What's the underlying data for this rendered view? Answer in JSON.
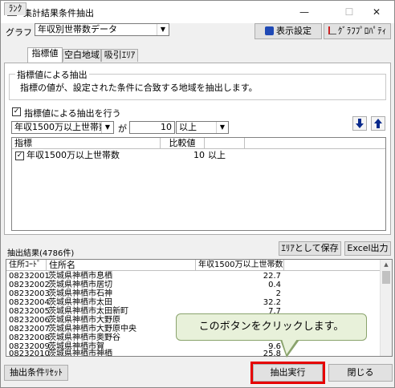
{
  "window": {
    "title": "集計結果条件抽出",
    "minimize": "—",
    "maximize": "☐",
    "close": "✕"
  },
  "graph": {
    "label": "グラフ",
    "selected": "年収別世帯数データ",
    "display_settings": "表示設定",
    "graph_properties": "ｸﾞﾗﾌﾌﾟﾛﾊﾟﾃｨ"
  },
  "tabs": [
    "ﾗﾝｸ",
    "指標値",
    "空白地域",
    "吸引ｴﾘｱ"
  ],
  "active_tab": 1,
  "indicator_group": {
    "title": "指標値による抽出",
    "description": "指標の値が、設定された条件に合致する地域を抽出します。"
  },
  "use_indicator": {
    "label": "指標値による抽出を行う",
    "checked": true
  },
  "condition": {
    "indicator": "年収1500万以上世帯数",
    "ga": "が",
    "value": "10",
    "operator": "以上"
  },
  "icons": {
    "down": "down-arrow-icon",
    "up": "up-arrow-icon"
  },
  "indicator_table": {
    "headers": [
      "指標",
      "比較値"
    ],
    "rows": [
      {
        "name": "年収1500万以上世帯数",
        "value": "10",
        "op": "以上",
        "checked": true
      }
    ]
  },
  "results": {
    "label": "抽出結果(4786件)",
    "save_area": "ｴﾘｱとして保存",
    "excel_output": "Excel出力",
    "headers": [
      "住所ｺｰﾄﾞ",
      "住所名",
      "年収1500万以上世帯数"
    ],
    "rows": [
      [
        "08232001",
        "茨城県神栖市息栖",
        "22.7"
      ],
      [
        "08232002",
        "茨城県神栖市居切",
        "0.4"
      ],
      [
        "08232003",
        "茨城県神栖市石神",
        "2"
      ],
      [
        "08232004",
        "茨城県神栖市太田",
        "32.2"
      ],
      [
        "08232005",
        "茨城県神栖市太田新町",
        "7.7"
      ],
      [
        "08232006",
        "茨城県神栖市大野原",
        ""
      ],
      [
        "08232007",
        "茨城県神栖市大野原中央",
        ""
      ],
      [
        "08232008",
        "茨城県神栖市奥野谷",
        ""
      ],
      [
        "08232009",
        "茨城県神栖市賀",
        "9.6"
      ],
      [
        "08232010",
        "茨城県神栖市神栖",
        "25.8"
      ]
    ]
  },
  "tooltip": "このボタンをクリックします。",
  "buttons": {
    "reset": "抽出条件ﾘｾｯﾄ",
    "execute": "抽出実行",
    "close": "閉じる"
  }
}
